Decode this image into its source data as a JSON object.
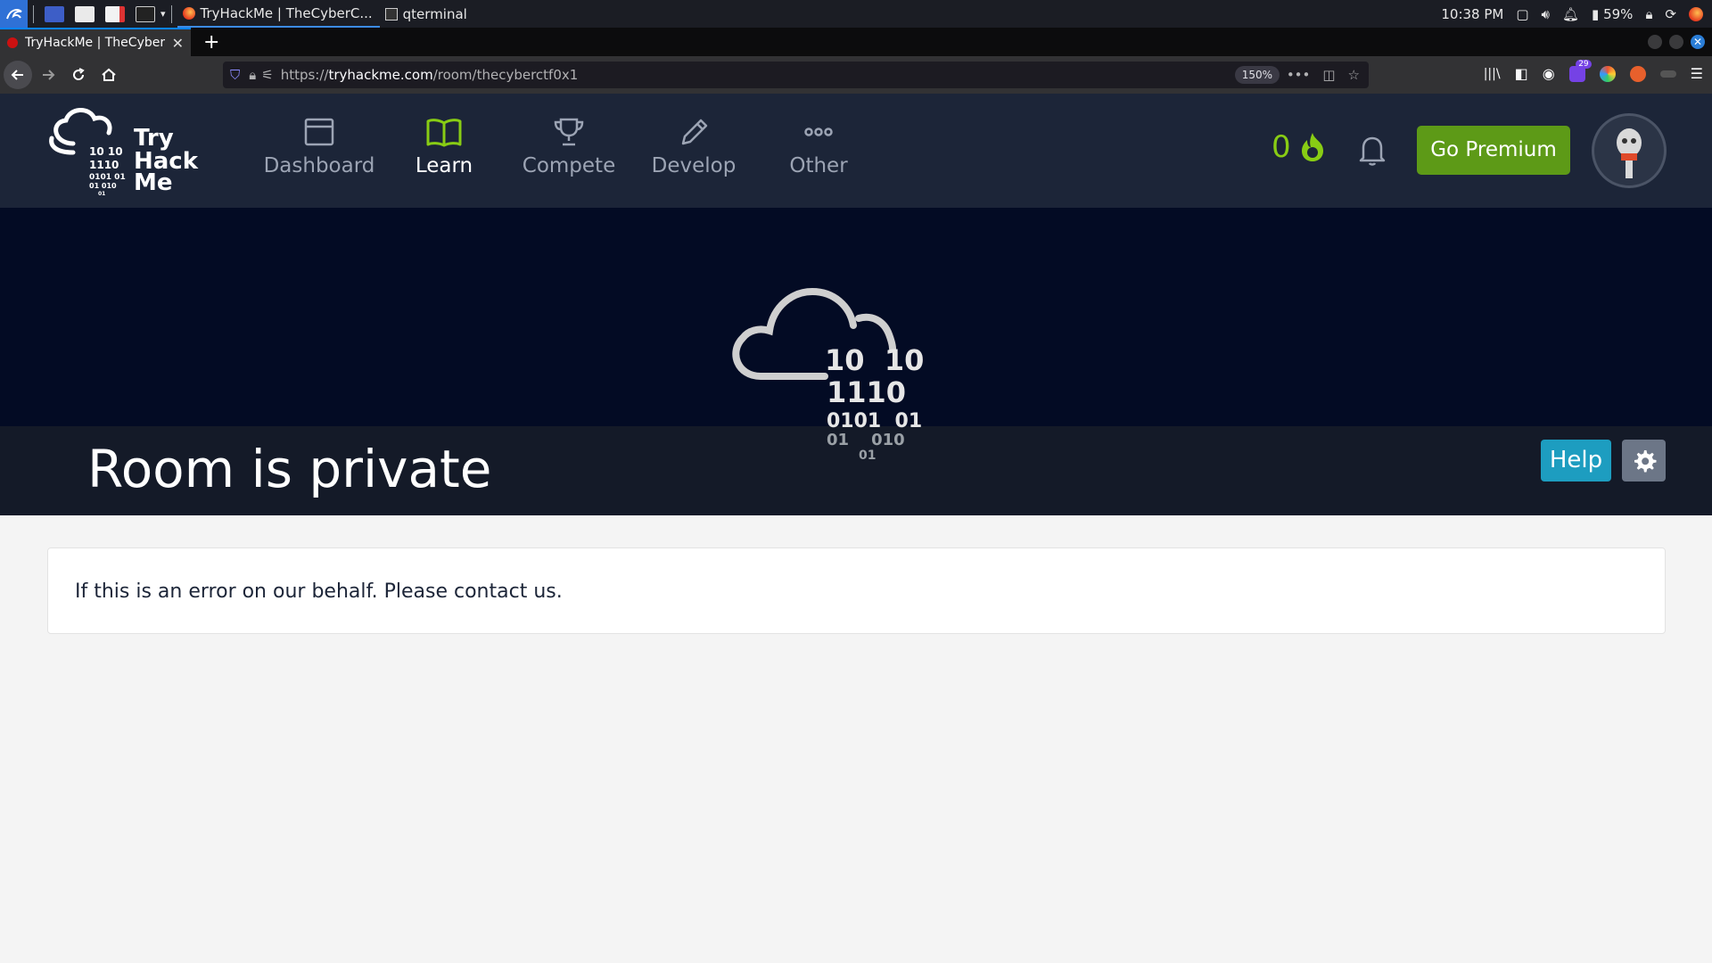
{
  "taskbar": {
    "windows": [
      {
        "label": "TryHackMe | TheCyberC...",
        "active": true
      },
      {
        "label": "qterminal",
        "active": false
      }
    ],
    "clock": "10:38 PM",
    "battery": "59%"
  },
  "browser": {
    "tab_title": "TryHackMe | TheCyberCTF",
    "new_tab": "+",
    "url_scheme": "https://",
    "url_host": "tryhackme.com",
    "url_path": "/room/thecyberctf0x1",
    "zoom": "150%",
    "extension_badge": "29"
  },
  "site": {
    "logo_lines": [
      "Try",
      "Hack",
      "Me"
    ],
    "logo_binary": [
      "10  10",
      "1110",
      "0101 01",
      "01  010",
      "01"
    ],
    "nav": [
      {
        "label": "Dashboard",
        "icon": "dashboard-icon",
        "active": false
      },
      {
        "label": "Learn",
        "icon": "book-icon",
        "active": true
      },
      {
        "label": "Compete",
        "icon": "trophy-icon",
        "active": false
      },
      {
        "label": "Develop",
        "icon": "pencil-icon",
        "active": false
      },
      {
        "label": "Other",
        "icon": "more-icon",
        "active": false
      }
    ],
    "streak": "0",
    "premium_label": "Go Premium",
    "accent": "#88cc14"
  },
  "room": {
    "title": "Room is private",
    "help_label": "Help",
    "hero_binary": [
      "10  10",
      "1110",
      "0101  01",
      "01    010",
      "01"
    ],
    "message": "If this is an error on our behalf. Please contact us."
  }
}
